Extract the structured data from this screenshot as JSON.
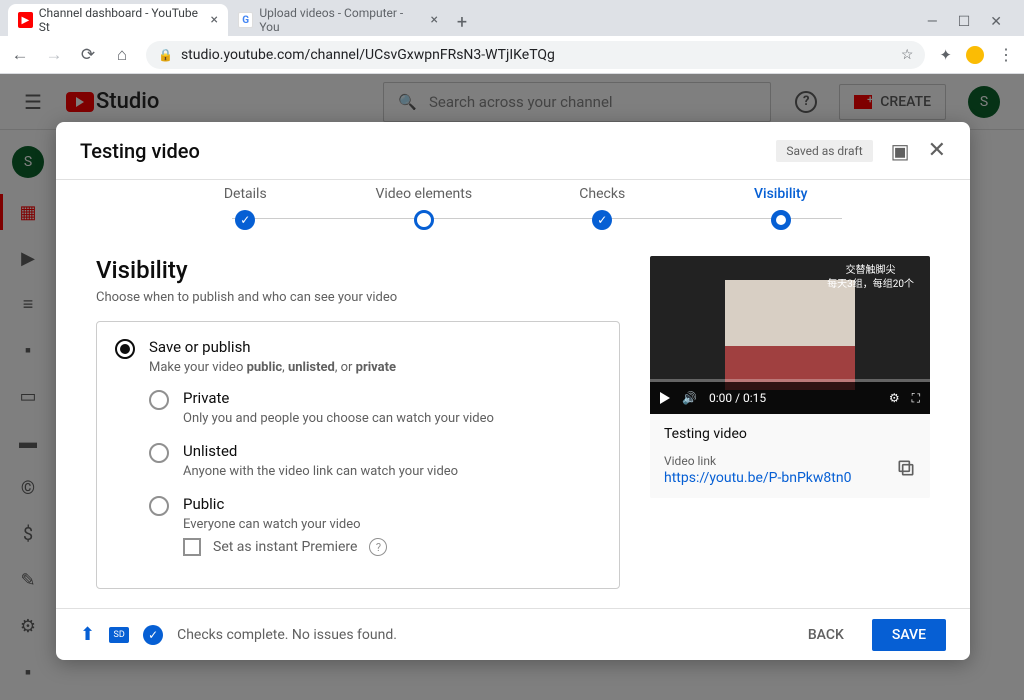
{
  "browser": {
    "tabs": [
      {
        "title": "Channel dashboard - YouTube St"
      },
      {
        "title": "Upload videos - Computer - You"
      }
    ],
    "url": "studio.youtube.com/channel/UCsvGxwpnFRsN3-WTjIKeTQg"
  },
  "header": {
    "logo": "Studio",
    "search_placeholder": "Search across your channel",
    "create_label": "CREATE",
    "avatar_initial": "S"
  },
  "dialog": {
    "title": "Testing video",
    "draft_badge": "Saved as draft",
    "steps": [
      "Details",
      "Video elements",
      "Checks",
      "Visibility"
    ],
    "section_title": "Visibility",
    "section_sub": "Choose when to publish and who can see your video",
    "save_or_publish": {
      "title": "Save or publish",
      "desc_pre": "Make your video ",
      "desc_b1": "public",
      "desc_mid": ", ",
      "desc_b2": "unlisted",
      "desc_mid2": ", or ",
      "desc_b3": "private"
    },
    "options": [
      {
        "title": "Private",
        "desc": "Only you and people you choose can watch your video"
      },
      {
        "title": "Unlisted",
        "desc": "Anyone with the video link can watch your video"
      },
      {
        "title": "Public",
        "desc": "Everyone can watch your video"
      }
    ],
    "premiere_label": "Set as instant Premiere",
    "preview": {
      "cn_line1": "交替触脚尖",
      "cn_line2": "每天3组，每组20个",
      "time": "0:00 / 0:15",
      "video_title": "Testing video",
      "link_label": "Video link",
      "link": "https://youtu.be/P-bnPkw8tn0"
    },
    "footer": {
      "status": "Checks complete. No issues found.",
      "back": "BACK",
      "save": "SAVE",
      "sd": "SD"
    }
  }
}
